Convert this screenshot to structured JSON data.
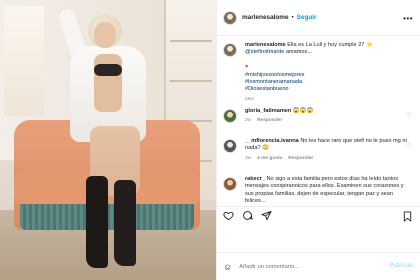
{
  "post": {
    "author": "marlenesalome",
    "follow_label": "Seguir",
    "more_label": "•••"
  },
  "caption": {
    "username": "marlenesalome",
    "line1": "Ella es La Luli y hoy cumple 27 ⭐",
    "mention": "@stefiroitmante",
    "line2": " amamos...",
    "heart": "♥",
    "hashtags": [
      "#mishijossonlosmejores",
      "#losmontaneramanada",
      "#Diosestanbueno"
    ],
    "time": "29w"
  },
  "comments": [
    {
      "username": "gloria_fatimamen",
      "text": "😱😱😱",
      "time": "2w",
      "reply_label": "Responder"
    },
    {
      "username": "__mflorencia.ivanna",
      "text": "No les hace raro que stefi no le puso mg ni nada? 😳",
      "time": "2w",
      "likes": "4 me gusta",
      "reply_label": "Responder"
    },
    {
      "username": "rakecr_",
      "text": "No sigo a esta familia pero estos días ha leído tantos mensajes conspiranoicos para ellos. Examinen sus corazones y sus propias familias, dejen de especular, tengan paz y sean felices...",
      "time": "",
      "reply_label": ""
    }
  ],
  "add_comment": {
    "placeholder": "Añadir un comentario...",
    "publish_label": "Publicar"
  },
  "icons": {
    "like": "heart-icon",
    "comment": "comment-icon",
    "share": "share-icon",
    "save": "bookmark-icon",
    "emoji": "emoji-icon",
    "more": "more-icon"
  },
  "colors": {
    "link": "#0095f6",
    "meta": "#8e8e8e",
    "text": "#262626",
    "border": "#efefef"
  }
}
